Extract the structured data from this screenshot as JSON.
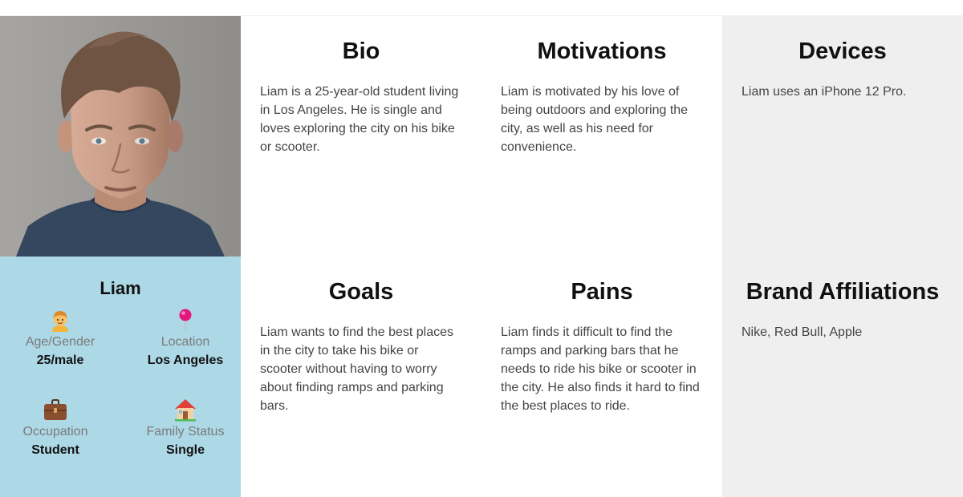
{
  "profile": {
    "name": "Liam",
    "attributes": [
      {
        "label": "Age/Gender",
        "value": "25/male",
        "icon": "person-icon"
      },
      {
        "label": "Location",
        "value": "Los Angeles",
        "icon": "pin-icon"
      },
      {
        "label": "Occupation",
        "value": "Student",
        "icon": "briefcase-icon"
      },
      {
        "label": "Family Status",
        "value": "Single",
        "icon": "house-icon"
      }
    ]
  },
  "sections": {
    "bio": {
      "title": "Bio",
      "text": "Liam is a 25-year-old student living in Los Angeles. He is single and loves exploring the city on his bike or scooter."
    },
    "motivations": {
      "title": "Motivations",
      "text": "Liam is motivated by his love of being outdoors and exploring the city, as well as his need for convenience."
    },
    "devices": {
      "title": "Devices",
      "text": "Liam uses an iPhone 12 Pro."
    },
    "goals": {
      "title": "Goals",
      "text": "Liam wants to find the best places in the city to take his bike or scooter without having to worry about finding ramps and parking bars."
    },
    "pains": {
      "title": "Pains",
      "text": "Liam finds it difficult to find the ramps and parking bars that he needs to ride his bike or scooter in the city. He also finds it hard to find the best places to ride."
    },
    "brand_affiliations": {
      "title": "Brand Affiliations",
      "text": "Nike, Red Bull, Apple"
    }
  },
  "colors": {
    "profile_bg": "#add8e6",
    "gray_card_bg": "#efefef"
  }
}
